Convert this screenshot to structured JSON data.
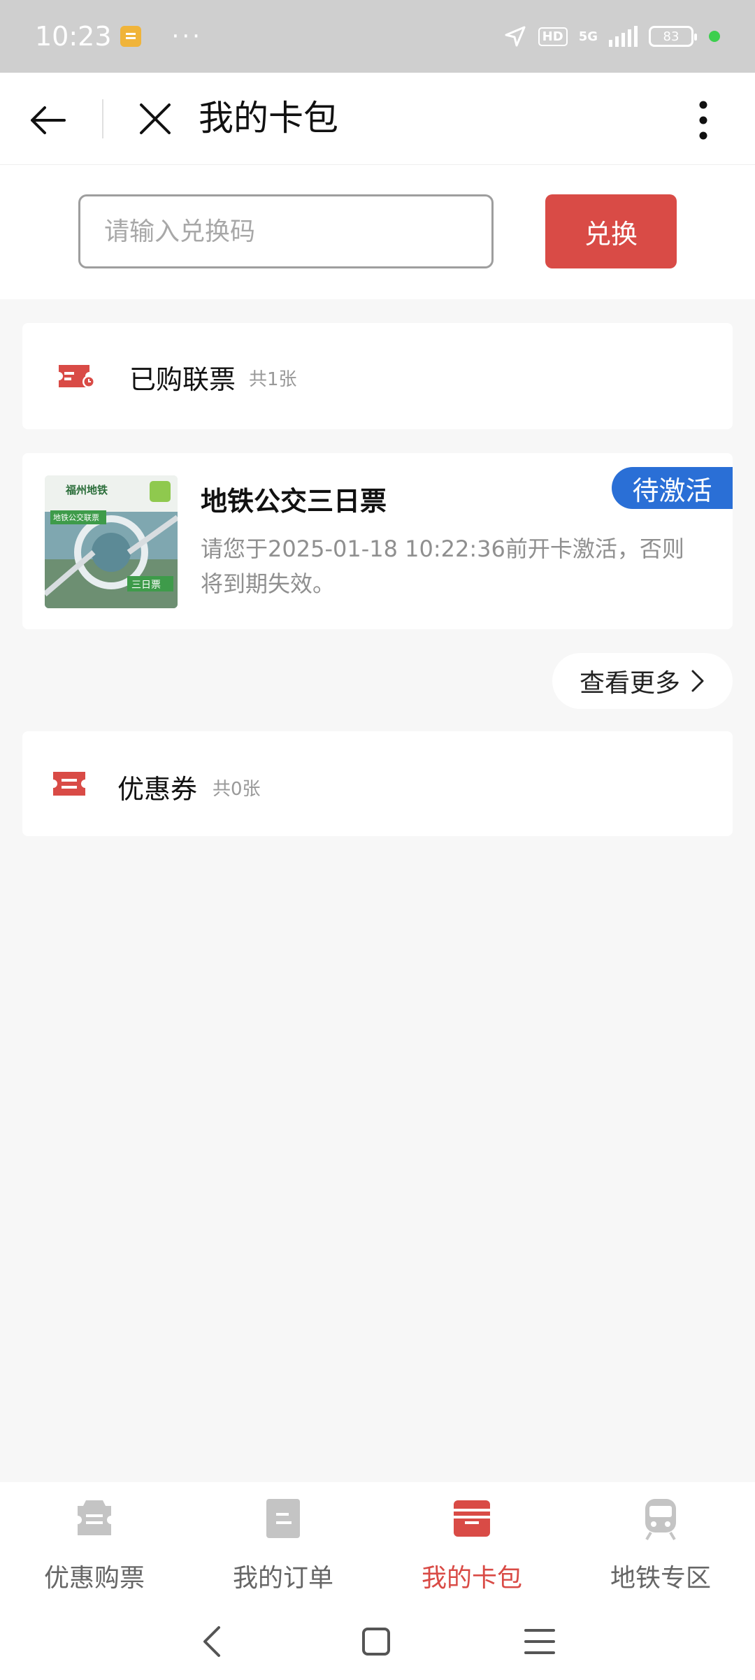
{
  "status_bar": {
    "time": "10:23",
    "dots": "···",
    "hd": "HD",
    "network": "5G",
    "battery": "83"
  },
  "header": {
    "title": "我的卡包"
  },
  "redeem": {
    "placeholder": "请输入兑换码",
    "button_label": "兑换"
  },
  "purchased": {
    "title": "已购联票",
    "count": "共1张"
  },
  "ticket": {
    "name": "地铁公交三日票",
    "status": "待激活",
    "description": "请您于2025-01-18 10:22:36前开卡激活，否则将到期失效。",
    "thumb_brand": "福州地铁",
    "thumb_tag": "地铁公交联票",
    "thumb_type": "三日票"
  },
  "view_more": {
    "label": "查看更多"
  },
  "coupon": {
    "title": "优惠券",
    "count": "共0张"
  },
  "tabs": [
    {
      "label": "优惠购票",
      "icon": "ticket-icon",
      "active": false
    },
    {
      "label": "我的订单",
      "icon": "order-icon",
      "active": false
    },
    {
      "label": "我的卡包",
      "icon": "wallet-icon",
      "active": true
    },
    {
      "label": "地铁专区",
      "icon": "train-icon",
      "active": false
    }
  ],
  "colors": {
    "accent": "#d94b46",
    "badge_blue": "#2a6fd6"
  }
}
